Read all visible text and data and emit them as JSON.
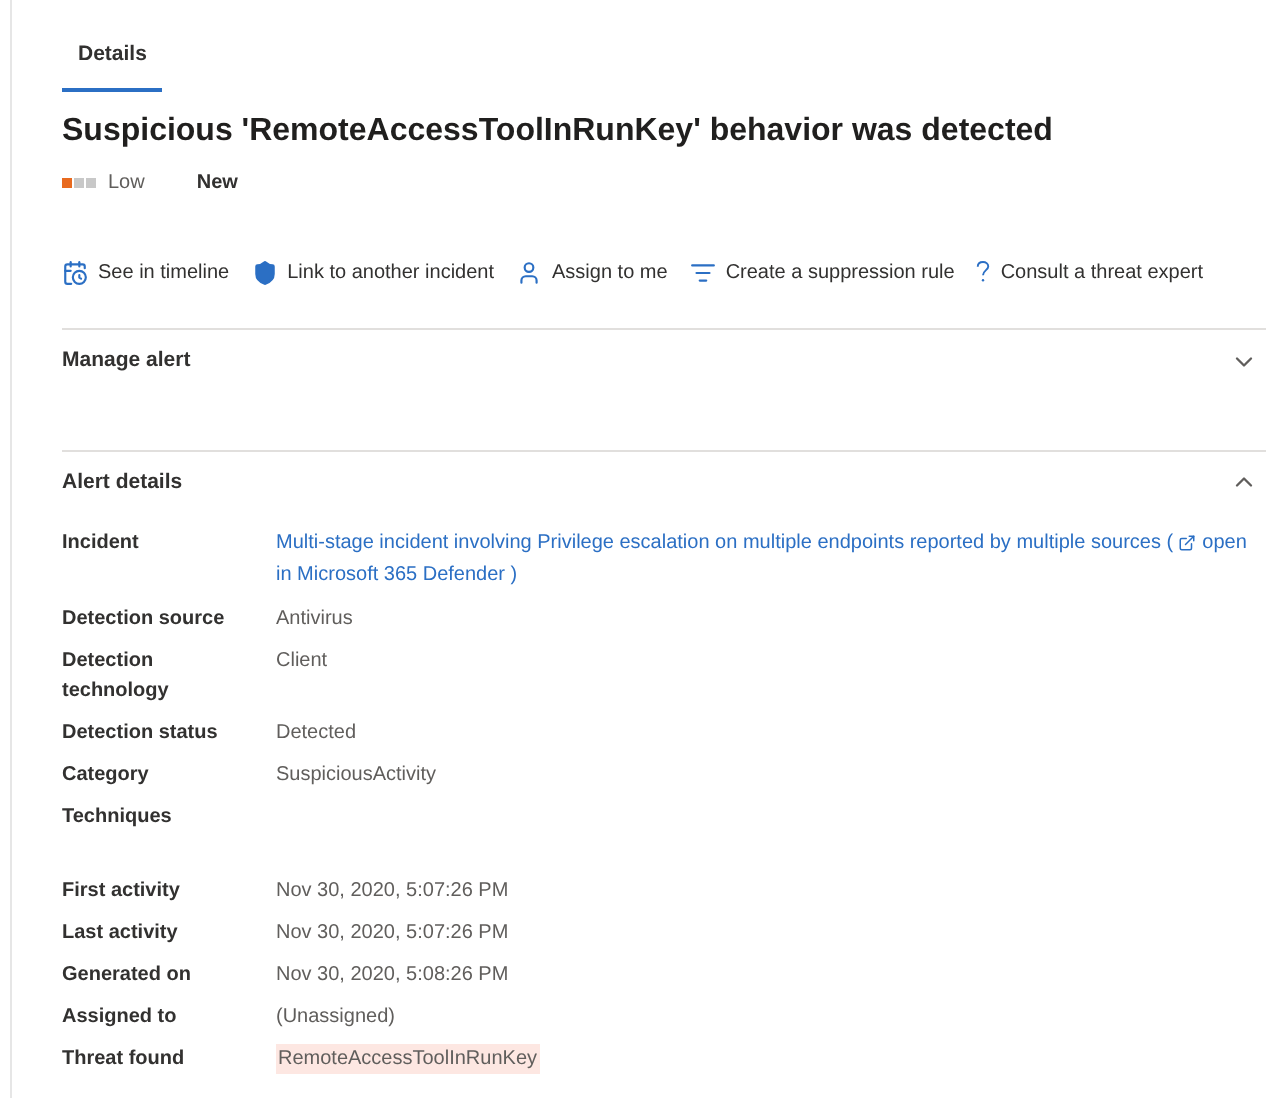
{
  "tabs": [
    {
      "label": "Details",
      "selected": true
    }
  ],
  "title": "Suspicious 'RemoteAccessToolInRunKey' behavior was detected",
  "severity": {
    "label": "Low",
    "level": 0.33
  },
  "status": "New",
  "actions": [
    {
      "kind": "timeline",
      "label": "See in timeline"
    },
    {
      "kind": "shield",
      "label": "Link to another incident"
    },
    {
      "kind": "person",
      "label": "Assign to me"
    },
    {
      "kind": "suppress",
      "label": "Create a suppression rule"
    },
    {
      "kind": "help",
      "label": "Consult a threat expert"
    }
  ],
  "sections": [
    {
      "title": "Manage alert",
      "expanded": false
    },
    {
      "title": "Alert details",
      "expanded": true
    }
  ],
  "details": [
    {
      "label": "Incident",
      "kind": "link",
      "value": "Multi-stage incident involving Privilege escalation on multiple endpoints reported by multiple sources (",
      "link": "open in Microsoft 365 Defender )"
    },
    {
      "label": "Detection source",
      "kind": "text",
      "value": "Antivirus"
    },
    {
      "label": "Detection technology",
      "kind": "text",
      "value": "Client"
    },
    {
      "label": "Detection status",
      "kind": "text",
      "value": "Detected"
    },
    {
      "label": "Category",
      "kind": "text",
      "value": "SuspiciousActivity"
    },
    {
      "label": "Techniques",
      "kind": "empty"
    },
    {
      "label": "First activity",
      "kind": "text",
      "value": "Nov 30, 2020, 5:07:26 PM"
    },
    {
      "label": "Last activity",
      "kind": "text",
      "value": "Nov 30, 2020, 5:07:26 PM"
    },
    {
      "label": "Generated on",
      "kind": "text",
      "value": "Nov 30, 2020, 5:08:26 PM"
    },
    {
      "label": "Assigned to",
      "kind": "text",
      "value": "(Unassigned)"
    },
    {
      "label": "Threat found",
      "kind": "highlight",
      "value": "RemoteAccessToolInRunKey"
    }
  ]
}
